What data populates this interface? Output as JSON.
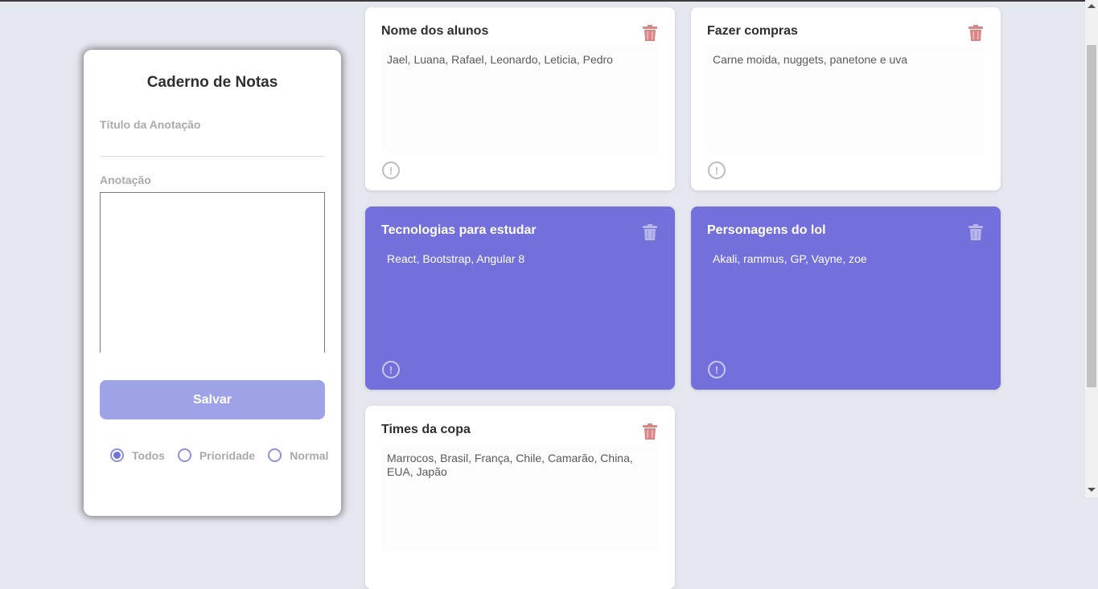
{
  "form": {
    "title": "Caderno de Notas",
    "title_label": "Título da Anotação",
    "title_value": "",
    "note_label": "Anotação",
    "note_value": "",
    "save_label": "Salvar",
    "filters": [
      {
        "label": "Todos",
        "checked": true
      },
      {
        "label": "Prioridade",
        "checked": false
      },
      {
        "label": "Normal",
        "checked": false
      }
    ]
  },
  "notes": [
    {
      "title": "Nome dos alunos",
      "body": "Jael, Luana, Rafael, Leonardo, Leticia, Pedro",
      "priority": false
    },
    {
      "title": "Fazer compras",
      "body": "Carne moida, nuggets, panetone e uva",
      "priority": false
    },
    {
      "title": "Tecnologias para estudar",
      "body": "React, Bootstrap, Angular 8",
      "priority": true
    },
    {
      "title": "Personagens do lol",
      "body": "Akali, rammus, GP, Vayne, zoe",
      "priority": true
    },
    {
      "title": "Times da copa",
      "body": "Marrocos, Brasil, França, Chile, Camarão, China, EUA, Japão",
      "priority": false
    }
  ],
  "icons": {
    "trash": "trash-icon",
    "alert": "exclamation-circle-icon"
  },
  "colors": {
    "background": "#e5e7ef",
    "priority_card": "#7370db",
    "normal_card": "#ffffff",
    "save_button": "#9ea3e7",
    "trash_white_card": "#d98585",
    "trash_purple_card": "#b7b6e8"
  }
}
